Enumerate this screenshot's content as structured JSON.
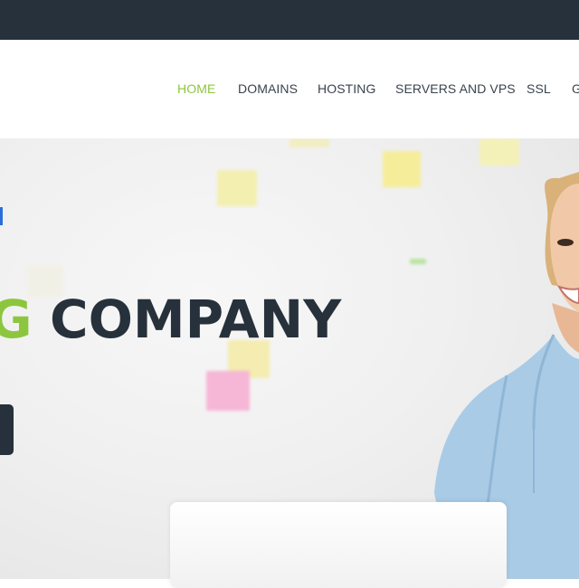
{
  "nav": {
    "items": [
      {
        "label": "HOME",
        "active": true
      },
      {
        "label": "DOMAINS",
        "active": false
      },
      {
        "label": "HOSTING",
        "active": false
      },
      {
        "label": "SERVERS AND VPS",
        "active": false
      },
      {
        "label": "SSL",
        "active": false
      },
      {
        "label": "G",
        "active": false
      }
    ]
  },
  "hero": {
    "headline_part1": "G",
    "headline_part2": "COMPANY"
  },
  "colors": {
    "topbar": "#27313b",
    "accent_green": "#8cc63f",
    "dark_text": "#27313b",
    "accent_blue": "#2b6fd6"
  }
}
